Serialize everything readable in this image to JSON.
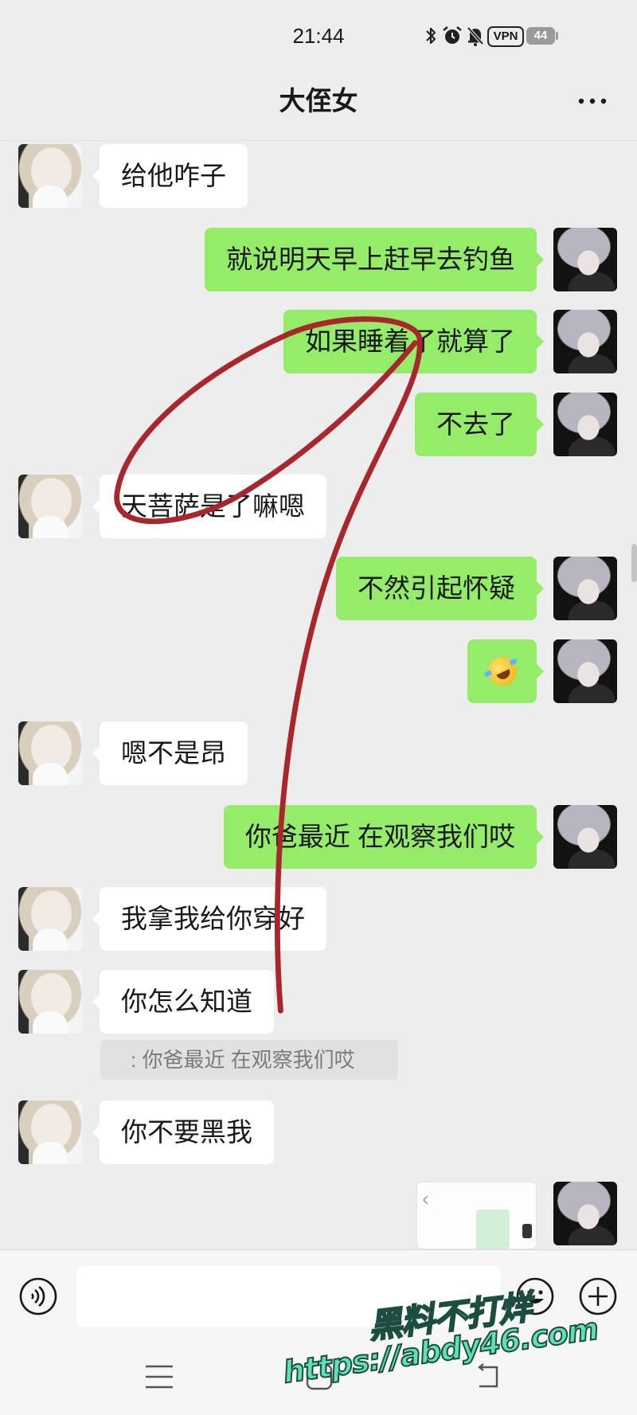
{
  "status_bar": {
    "time": "21:44",
    "vpn_label": "VPN",
    "battery_level": "44",
    "icons": [
      "bluetooth-icon",
      "alarm-icon",
      "mute-bell-icon",
      "vpn-icon",
      "battery-icon"
    ]
  },
  "header": {
    "title": "大侄女",
    "more_icon": "more-dots-icon"
  },
  "messages": [
    {
      "outgoing": false,
      "text": "给他咋子"
    },
    {
      "outgoing": true,
      "text": "就说明天早上赶早去钓鱼"
    },
    {
      "outgoing": true,
      "text": "如果睡着了就算了"
    },
    {
      "outgoing": true,
      "text": "不去了"
    },
    {
      "outgoing": false,
      "text": "天菩萨是了嘛嗯"
    },
    {
      "outgoing": true,
      "text": "不然引起怀疑"
    },
    {
      "outgoing": true,
      "emoji_icon": "rolling-on-the-floor-laughing-emoji"
    },
    {
      "outgoing": false,
      "text": "嗯不是昂"
    },
    {
      "outgoing": true,
      "text": "你爸最近 在观察我们哎"
    },
    {
      "outgoing": false,
      "text": "我拿我给你穿好"
    },
    {
      "outgoing": false,
      "text": "你怎么知道",
      "quote": ": 你爸最近 在观察我们哎"
    },
    {
      "outgoing": false,
      "text": "你不要黑我"
    },
    {
      "outgoing": true,
      "image_icon": "image-thumbnail"
    }
  ],
  "input_bar": {
    "value": "",
    "icons": [
      "voice-icon",
      "emoji-icon",
      "plus-icon"
    ]
  },
  "nav_bar": {
    "icons": [
      "menu-icon",
      "home-icon",
      "back-icon"
    ]
  },
  "watermark": {
    "line1": "黑料不打烊",
    "line2": "https://abdy46.com"
  },
  "colors": {
    "background": "#ededed",
    "incoming_bubble": "#ffffff",
    "outgoing_bubble": "#95ec69",
    "annotation_stroke": "#a8262c",
    "watermark_fill": "#5fe0b6"
  }
}
